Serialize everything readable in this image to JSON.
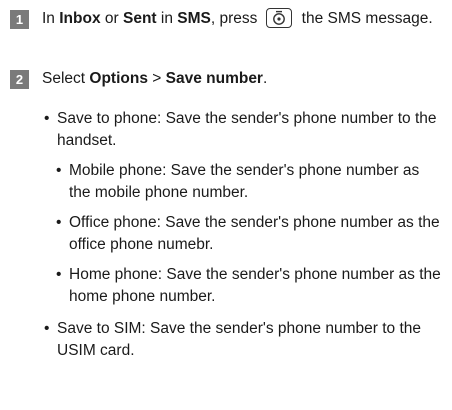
{
  "steps": [
    {
      "number": "1",
      "parts": {
        "a": "In ",
        "b": "Inbox",
        "c": " or ",
        "d": "Sent",
        "e": " in ",
        "f": "SMS",
        "g": ", press",
        "h": " the SMS message."
      },
      "icon": "center-key-icon"
    },
    {
      "number": "2",
      "parts": {
        "a": "Select ",
        "b": "Options",
        "c": " > ",
        "d": "Save number",
        "e": "."
      }
    }
  ],
  "options": [
    {
      "bullet": "•",
      "text": "Save to phone: Save the sender's phone number to the handset.",
      "level": 1
    },
    {
      "bullet": "•",
      "text": "Mobile phone: Save the sender's phone number as the mobile phone number.",
      "level": 2
    },
    {
      "bullet": "•",
      "text": "Office phone: Save the sender's phone number as the office phone numebr.",
      "level": 2
    },
    {
      "bullet": "•",
      "text": "Home phone: Save the sender's phone number as the home phone number.",
      "level": 2
    },
    {
      "bullet": "•",
      "text": "Save to SIM: Save the sender's phone number to the USIM card.",
      "level": 1
    }
  ]
}
